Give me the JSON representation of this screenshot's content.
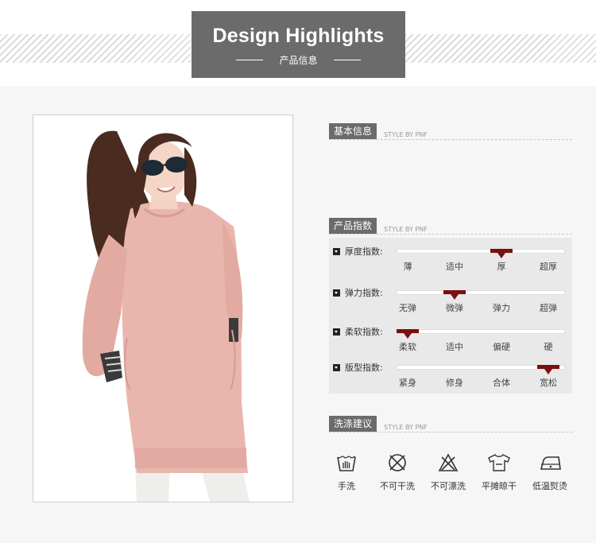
{
  "banner": {
    "title": "Design Highlights",
    "subtitle": "产品信息"
  },
  "sections": {
    "basic": {
      "label": "基本信息",
      "style": "STYLE BY PNF"
    },
    "index": {
      "label": "产品指数",
      "style": "STYLE BY PNF"
    },
    "wash": {
      "label": "洗涤建议",
      "style": "STYLE BY PNF"
    }
  },
  "index_rows": [
    {
      "label": "厚度指数:",
      "options": [
        "薄",
        "适中",
        "厚",
        "超厚"
      ],
      "selected_index": 2
    },
    {
      "label": "弹力指数:",
      "options": [
        "无弹",
        "微弹",
        "弹力",
        "超弹"
      ],
      "selected_index": 1
    },
    {
      "label": "柔软指数:",
      "options": [
        "柔软",
        "适中",
        "偏硬",
        "硬"
      ],
      "selected_index": 0
    },
    {
      "label": "版型指数:",
      "options": [
        "紧身",
        "修身",
        "合体",
        "宽松"
      ],
      "selected_index": 3
    }
  ],
  "care": [
    {
      "icon": "hand-wash-icon",
      "label": "手洗"
    },
    {
      "icon": "no-dry-clean-icon",
      "label": "不可干洗"
    },
    {
      "icon": "no-bleach-icon",
      "label": "不可漂洗"
    },
    {
      "icon": "flat-dry-icon",
      "label": "平摊晾干"
    },
    {
      "icon": "low-iron-icon",
      "label": "低温熨烫"
    }
  ],
  "colors": {
    "banner_bg": "#6b6b6b",
    "marker": "#7a1010",
    "garment": "#e9b6ad"
  }
}
